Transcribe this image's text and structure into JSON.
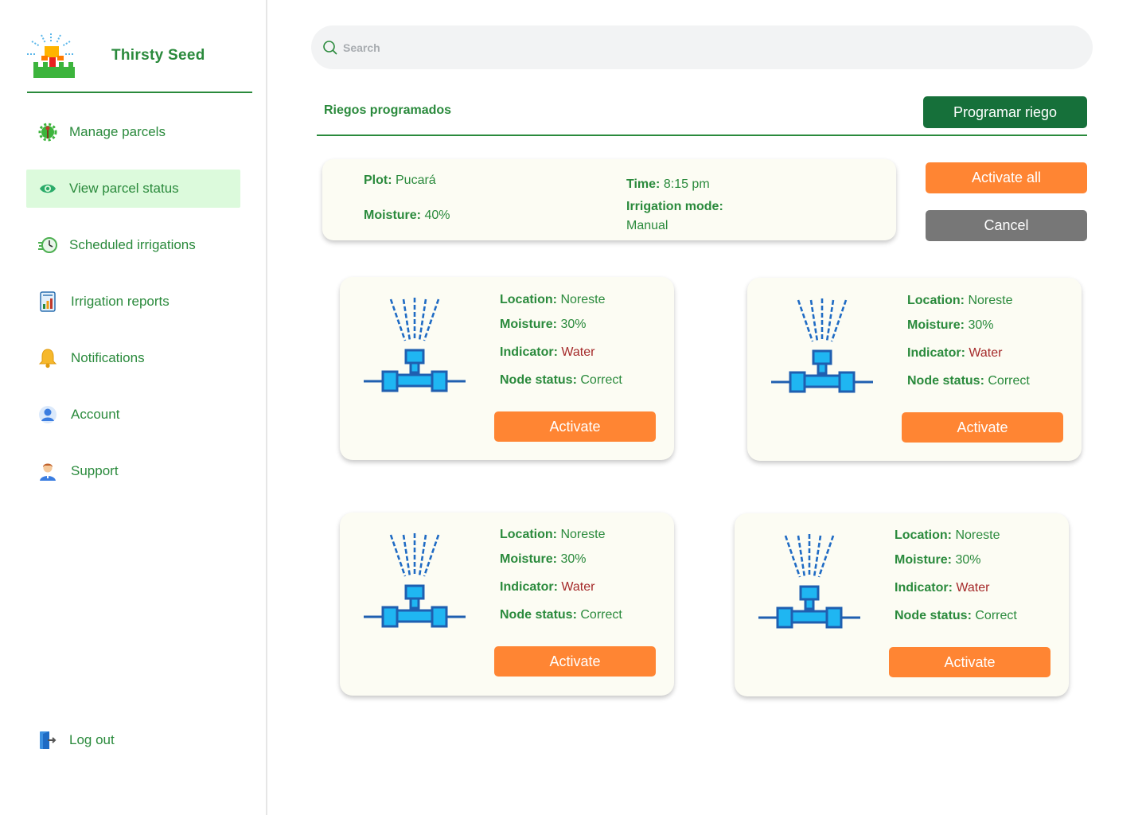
{
  "app": {
    "name": "Thirsty Seed"
  },
  "sidebar": {
    "items": [
      {
        "label": "Manage parcels",
        "icon": "plant-gear-icon"
      },
      {
        "label": "View parcel status",
        "icon": "eye-icon",
        "active": true
      },
      {
        "label": "Scheduled irrigations",
        "icon": "clock-icon"
      },
      {
        "label": "Irrigation reports",
        "icon": "report-chart-icon"
      },
      {
        "label": "Notifications",
        "icon": "bell-icon"
      },
      {
        "label": "Account",
        "icon": "user-icon"
      },
      {
        "label": "Support",
        "icon": "support-agent-icon"
      }
    ],
    "logout": {
      "label": "Log out",
      "icon": "logout-icon"
    }
  },
  "search": {
    "placeholder": "Search"
  },
  "header": {
    "title": "Riegos programados",
    "schedule_button": "Programar riego"
  },
  "summary": {
    "plot_label": "Plot:",
    "plot_value": "Pucará",
    "moisture_label": "Moisture:",
    "moisture_value": "40%",
    "time_label": "Time:",
    "time_value": "8:15 pm",
    "mode_label": "Irrigation mode:",
    "mode_value": "Manual"
  },
  "actions": {
    "activate_all": "Activate all",
    "cancel": "Cancel"
  },
  "nodes": [
    {
      "location_label": "Location:",
      "location": "Noreste",
      "moisture_label": "Moisture:",
      "moisture": "30%",
      "indicator_label": "Indicator:",
      "indicator": "Water",
      "status_label": "Node status:",
      "status": "Correct",
      "button": "Activate"
    },
    {
      "location_label": "Location:",
      "location": "Noreste",
      "moisture_label": "Moisture:",
      "moisture": "30%",
      "indicator_label": "Indicator:",
      "indicator": "Water",
      "status_label": "Node status:",
      "status": "Correct",
      "button": "Activate"
    },
    {
      "location_label": "Location:",
      "location": "Noreste",
      "moisture_label": "Moisture:",
      "moisture": "30%",
      "indicator_label": "Indicator:",
      "indicator": "Water",
      "status_label": "Node status:",
      "status": "Correct",
      "button": "Activate"
    },
    {
      "location_label": "Location:",
      "location": "Noreste",
      "moisture_label": "Moisture:",
      "moisture": "30%",
      "indicator_label": "Indicator:",
      "indicator": "Water",
      "status_label": "Node status:",
      "status": "Correct",
      "button": "Activate"
    }
  ],
  "colors": {
    "brand_green": "#2a8a3c",
    "dark_green": "#16703a",
    "orange": "#ff8533",
    "gray": "#777777",
    "active_bg": "#dcfadc",
    "indicator_red": "#a52a2a"
  }
}
